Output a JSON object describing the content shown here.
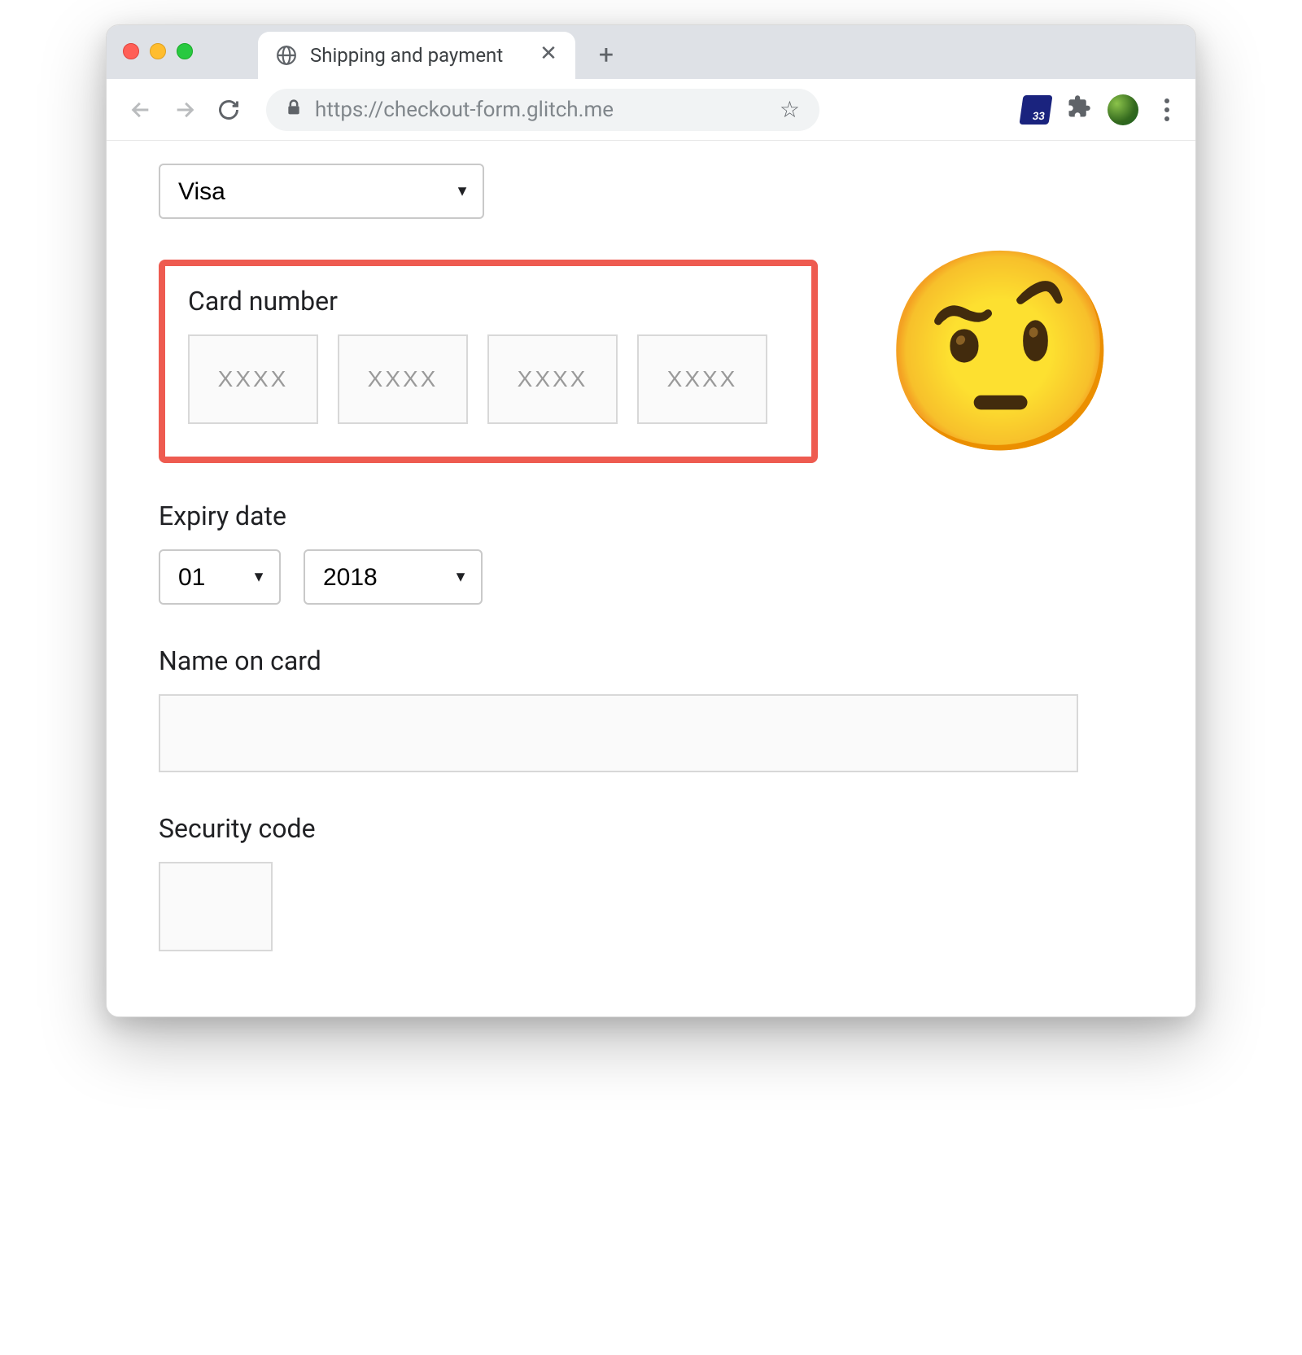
{
  "browser": {
    "tab_title": "Shipping and payment",
    "url": "https://checkout-form.glitch.me",
    "extension_badge": "33"
  },
  "form": {
    "card_type": {
      "selected": "Visa"
    },
    "card_number": {
      "label": "Card number",
      "placeholder": "XXXX"
    },
    "expiry": {
      "label": "Expiry date",
      "month": "01",
      "year": "2018"
    },
    "name": {
      "label": "Name on card"
    },
    "cvv": {
      "label": "Security code"
    }
  },
  "annotation": {
    "emoji": "🤨",
    "highlight_color": "#ee5b50"
  }
}
